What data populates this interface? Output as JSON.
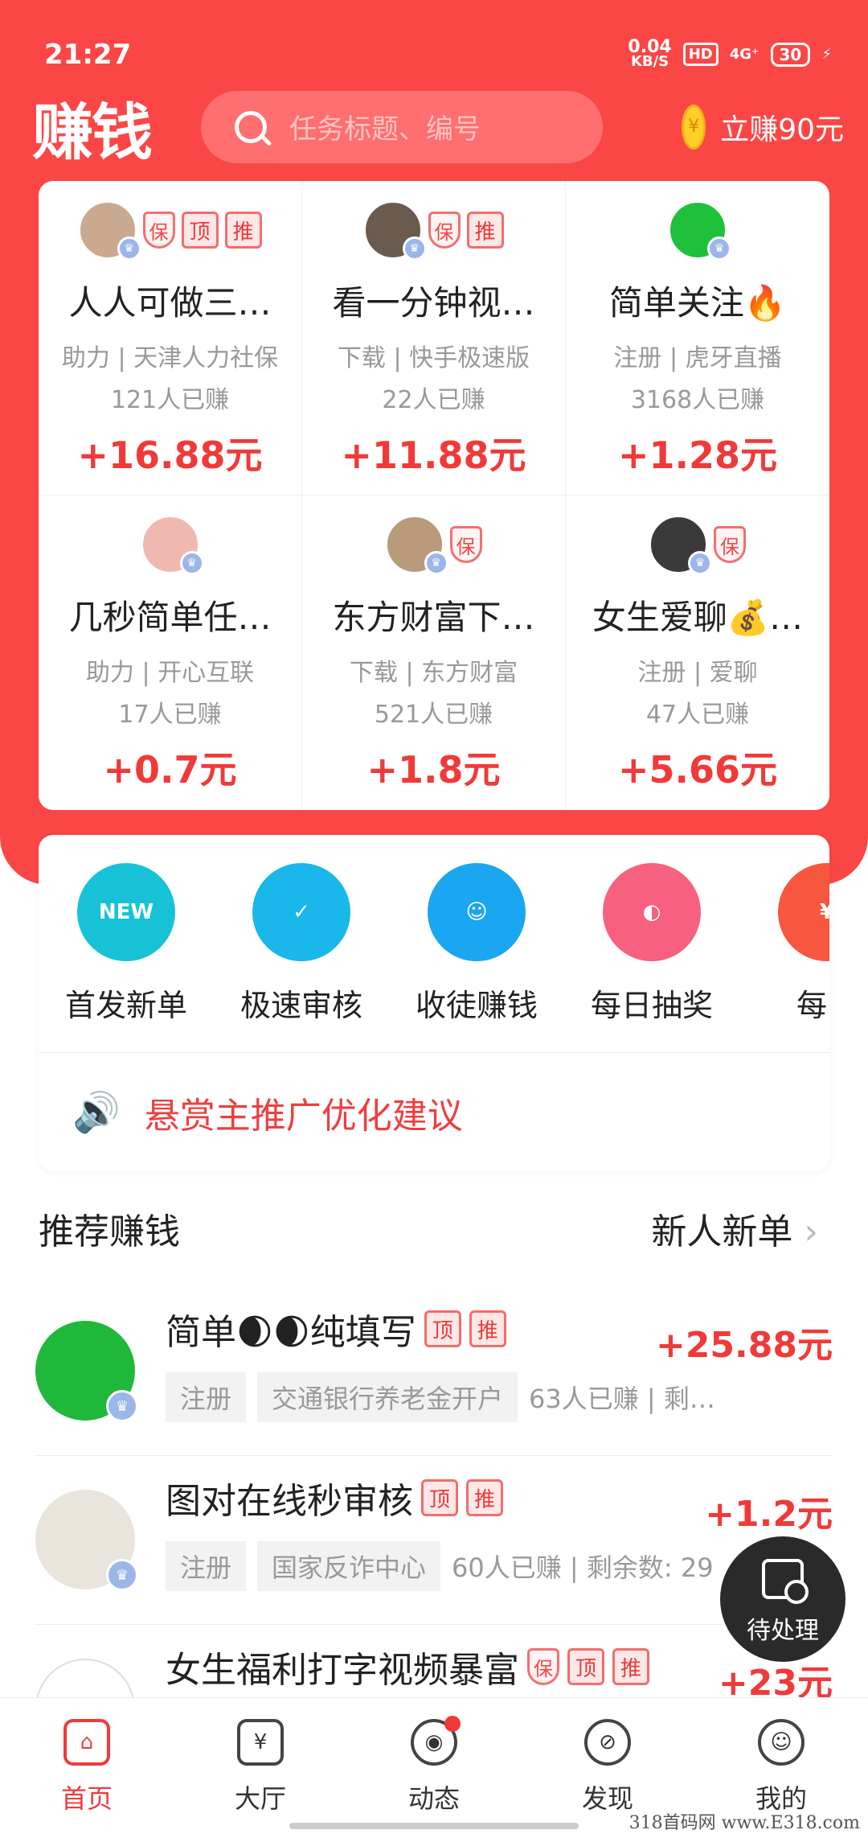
{
  "status_bar": {
    "time": "21:27",
    "net_speed": "0.04",
    "net_unit": "KB/S",
    "hd": "HD",
    "signal": "4G⁺",
    "battery": "30"
  },
  "header": {
    "logo": "赚钱",
    "search_placeholder": "任务标题、编号",
    "earn_label": "立赚90元",
    "coin_symbol": "¥"
  },
  "grid": [
    {
      "title": "人人可做三…",
      "subtitle": "助力 | 天津人力社保",
      "count": "121人已赚",
      "price": "+16.88元",
      "tags": [
        "保",
        "顶",
        "推"
      ],
      "avatar_color": "#c9a98f"
    },
    {
      "title": "看一分钟视…",
      "subtitle": "下载 | 快手极速版",
      "count": "22人已赚",
      "price": "+11.88元",
      "tags": [
        "保",
        "推"
      ],
      "avatar_color": "#6b5a4e"
    },
    {
      "title": "简单关注🔥",
      "subtitle": "注册 | 虎牙直播",
      "count": "3168人已赚",
      "price": "+1.28元",
      "tags": [],
      "avatar_color": "#1fc13a"
    },
    {
      "title": "几秒简单任…",
      "subtitle": "助力 | 开心互联",
      "count": "17人已赚",
      "price": "+0.7元",
      "tags": [],
      "avatar_color": "#f0b9b0"
    },
    {
      "title": "东方财富下…",
      "subtitle": "下载 | 东方财富",
      "count": "521人已赚",
      "price": "+1.8元",
      "tags": [
        "保"
      ],
      "avatar_color": "#b99a7a"
    },
    {
      "title": "女生爱聊💰…",
      "subtitle": "注册 | 爱聊",
      "count": "47人已赚",
      "price": "+5.66元",
      "tags": [
        "保"
      ],
      "avatar_color": "#3a3a3a"
    }
  ],
  "features": [
    {
      "label": "首发新单",
      "icon_text": "NEW",
      "color": "#18c2d6"
    },
    {
      "label": "极速审核",
      "icon_text": "✓",
      "color": "#19b7ea"
    },
    {
      "label": "收徒赚钱",
      "icon_text": "☺",
      "color": "#1aa6f0"
    },
    {
      "label": "每日抽奖",
      "icon_text": "◐",
      "color": "#f7607f"
    },
    {
      "label": "每日",
      "icon_text": "¥",
      "color": "#f7563f"
    }
  ],
  "notice": {
    "text": "悬赏主推广优化建议"
  },
  "recommend": {
    "title": "推荐赚钱",
    "more": "新人新单"
  },
  "list": [
    {
      "title": "简单🌒🌒纯填写",
      "tags": [
        "顶",
        "推"
      ],
      "price": "+25.88元",
      "chip1": "注册",
      "chip2": "交通银行养老金开户",
      "tail": "63人已赚 | 剩…",
      "avatar_color": "#1fb83a"
    },
    {
      "title": "图对在线秒审核",
      "tags": [
        "顶",
        "推"
      ],
      "price": "+1.2元",
      "chip1": "注册",
      "chip2": "国家反诈中心",
      "tail": "60人已赚 | 剩余数: 29",
      "avatar_color": "#e9e4dc"
    },
    {
      "title": "女生福利打字视频暴富",
      "tags": [
        "保",
        "顶",
        "推"
      ],
      "price": "+23元",
      "chip1": "",
      "chip2": "",
      "tail": "",
      "avatar_color": "#ffffff"
    }
  ],
  "fab": {
    "label": "待处理"
  },
  "nav": [
    {
      "label": "首页",
      "icon": "⌂"
    },
    {
      "label": "大厅",
      "icon": "¥"
    },
    {
      "label": "动态",
      "icon": "◉"
    },
    {
      "label": "发现",
      "icon": "⊘"
    },
    {
      "label": "我的",
      "icon": "☺"
    }
  ],
  "watermark": "318首码网  www.E318.com"
}
